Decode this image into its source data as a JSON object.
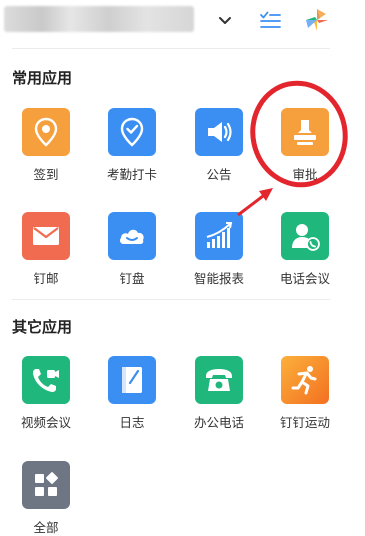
{
  "header": {
    "org_name": "",
    "dropdown_icon": "chevron-down-icon",
    "filter_icon": "checklist-filter-icon",
    "logo_icon": "dingtalk-logo-icon"
  },
  "sections": [
    {
      "title": "常用应用",
      "apps": [
        {
          "label": "签到",
          "icon": "location-checkin-icon",
          "color": "#f5a03d"
        },
        {
          "label": "考勤打卡",
          "icon": "attendance-check-icon",
          "color": "#3c8ff2"
        },
        {
          "label": "公告",
          "icon": "megaphone-icon",
          "color": "#3c8ff2"
        },
        {
          "label": "审批",
          "icon": "stamp-icon",
          "color": "#f5a03d"
        },
        {
          "label": "钉邮",
          "icon": "mail-icon",
          "color": "#f06b4f"
        },
        {
          "label": "钉盘",
          "icon": "cloud-disk-icon",
          "color": "#3c8ff2"
        },
        {
          "label": "智能报表",
          "icon": "chart-report-icon",
          "color": "#3c8ff2"
        },
        {
          "label": "电话会议",
          "icon": "phone-conference-icon",
          "color": "#1fb77c"
        }
      ]
    },
    {
      "title": "其它应用",
      "apps": [
        {
          "label": "视频会议",
          "icon": "video-call-icon",
          "color": "#1fb77c"
        },
        {
          "label": "日志",
          "icon": "notebook-icon",
          "color": "#3c8ff2"
        },
        {
          "label": "办公电话",
          "icon": "office-phone-icon",
          "color": "#1fb77c"
        },
        {
          "label": "钉钉运动",
          "icon": "running-icon",
          "color": "#f78b2a"
        },
        {
          "label": "全部",
          "icon": "all-apps-icon",
          "color": "#6e7684"
        }
      ]
    }
  ],
  "annotation_color": "#e3262e"
}
